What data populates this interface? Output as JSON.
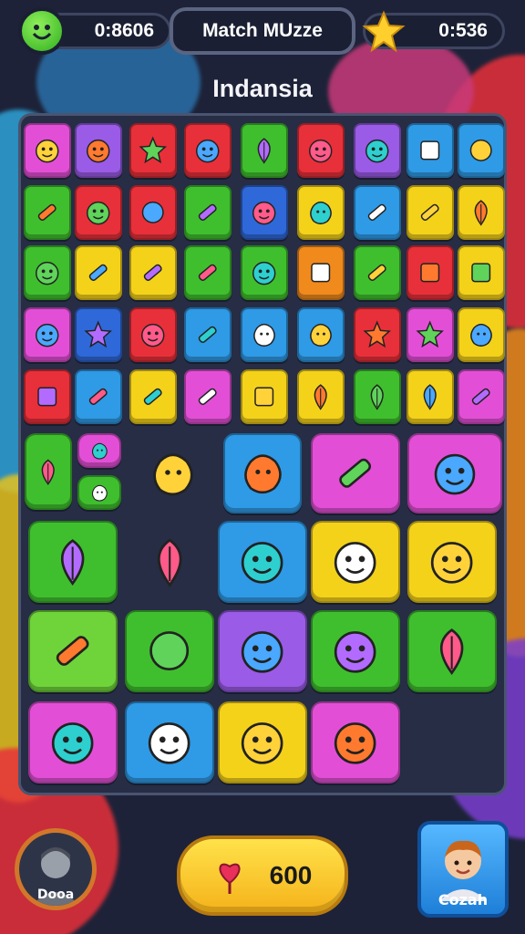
{
  "header": {
    "left_counter": "0:8606",
    "title": "Match MUzze",
    "right_counter": "0:536",
    "left_icon": "smiley-icon",
    "right_icon": "star-icon"
  },
  "level_name": "Indansia",
  "board": {
    "tiles": [
      {
        "icon": "alien-icon",
        "color": "#e24fd6"
      },
      {
        "icon": "orange-creature-icon",
        "color": "#9a5be6"
      },
      {
        "icon": "blue-star-icon",
        "color": "#e8303a"
      },
      {
        "icon": "face-icon",
        "color": "#e8303a"
      },
      {
        "icon": "carrot-icon",
        "color": "#3fbf2e"
      },
      {
        "icon": "cat-icon",
        "color": "#e8303a"
      },
      {
        "icon": "cat-icon",
        "color": "#9a5be6"
      },
      {
        "icon": "letter-a-icon",
        "color": "#2f9ae6"
      },
      {
        "icon": "red-ball-icon",
        "color": "#2f9ae6"
      },
      {
        "icon": "log-icon",
        "color": "#3fbf2e"
      },
      {
        "icon": "bear-icon",
        "color": "#e8303a"
      },
      {
        "icon": "purple-ball-icon",
        "color": "#e8303a"
      },
      {
        "icon": "rocket-icon",
        "color": "#3fbf2e"
      },
      {
        "icon": "fish-icon",
        "color": "#2f68d8"
      },
      {
        "icon": "green-blob-icon",
        "color": "#f4d21a"
      },
      {
        "icon": "bottle-icon",
        "color": "#2f9ae6"
      },
      {
        "icon": "pencil-icon",
        "color": "#f4d21a"
      },
      {
        "icon": "leaf-icon",
        "color": "#f4d21a"
      },
      {
        "icon": "owl-icon",
        "color": "#3fbf2e"
      },
      {
        "icon": "striped-tube-icon",
        "color": "#f4d21a"
      },
      {
        "icon": "crayon-icon",
        "color": "#f4d21a"
      },
      {
        "icon": "brush-icon",
        "color": "#3fbf2e"
      },
      {
        "icon": "pink-ghost-icon",
        "color": "#3fbf2e"
      },
      {
        "icon": "stump-icon",
        "color": "#f08a1c"
      },
      {
        "icon": "bone-icon",
        "color": "#3fbf2e"
      },
      {
        "icon": "potion-icon",
        "color": "#e8303a"
      },
      {
        "icon": "flag-icon",
        "color": "#f4d21a"
      },
      {
        "icon": "blue-monster-icon",
        "color": "#e24fd6"
      },
      {
        "icon": "flame-icon",
        "color": "#2f68d8"
      },
      {
        "icon": "purple-creature-icon",
        "color": "#e8303a"
      },
      {
        "icon": "key-icon",
        "color": "#2f9ae6"
      },
      {
        "icon": "check-shape-icon",
        "color": "#2f9ae6"
      },
      {
        "icon": "ufo-icon",
        "color": "#2f9ae6"
      },
      {
        "icon": "gem-icon",
        "color": "#e8303a"
      },
      {
        "icon": "crystal-icon",
        "color": "#e24fd6"
      },
      {
        "icon": "spinning-top-icon",
        "color": "#f4d21a"
      },
      {
        "icon": "box-icon",
        "color": "#e8303a"
      },
      {
        "icon": "wrench-icon",
        "color": "#2f9ae6"
      },
      {
        "icon": "thumb-icon",
        "color": "#f4d21a"
      },
      {
        "icon": "pen-icon",
        "color": "#e24fd6"
      },
      {
        "icon": "purple-button-icon",
        "color": "#f4d21a"
      },
      {
        "icon": "apple-icon",
        "color": "#f4d21a"
      },
      {
        "icon": "leaf-icon",
        "color": "#3fbf2e"
      },
      {
        "icon": "bell-icon",
        "color": "#f4d21a"
      },
      {
        "icon": "lollipop-icon",
        "color": "#e24fd6"
      },
      {
        "icon": "bean-icon",
        "color": "#3fbf2e"
      },
      {
        "icon": "worm-icon",
        "color": "#e24fd6"
      },
      {
        "icon": "swirl-icon",
        "color": "#3fbf2e"
      },
      {
        "icon": "pink-shape-icon",
        "color": "#262d45"
      },
      {
        "icon": "music-note-icon",
        "color": "#2f9ae6"
      },
      {
        "icon": "roller-icon",
        "color": "#e24fd6"
      },
      {
        "icon": "pumpkin-face-icon",
        "color": "#e24fd6"
      },
      {
        "icon": "red-leaf-icon",
        "color": "#3fbf2e"
      },
      {
        "icon": "green-apple-icon",
        "color": "#262d45"
      },
      {
        "icon": "cookie-face-icon",
        "color": "#2f9ae6"
      },
      {
        "icon": "orange-face-icon",
        "color": "#f4d21a"
      },
      {
        "icon": "bow-face-icon",
        "color": "#f4d21a"
      },
      {
        "icon": "glue-stick-icon",
        "color": "#6fd43a"
      },
      {
        "icon": "yellow-fruit-icon",
        "color": "#3fbf2e"
      },
      {
        "icon": "sun-face-icon",
        "color": "#9a5be6"
      },
      {
        "icon": "frog-monster-icon",
        "color": "#3fbf2e"
      },
      {
        "icon": "green-hat-icon",
        "color": "#3fbf2e"
      },
      {
        "icon": "blue-drop-face-icon",
        "color": "#e24fd6"
      },
      {
        "icon": "red-bird-icon",
        "color": "#2f9ae6"
      },
      {
        "icon": "fish-cross-icon",
        "color": "#f4d21a"
      },
      {
        "icon": "sunflower-face-icon",
        "color": "#e24fd6"
      }
    ]
  },
  "footer": {
    "left_avatar_label": "Dooa",
    "score_value": "600",
    "score_icon": "heart-pin-icon",
    "right_avatar_label": "Cozah"
  }
}
